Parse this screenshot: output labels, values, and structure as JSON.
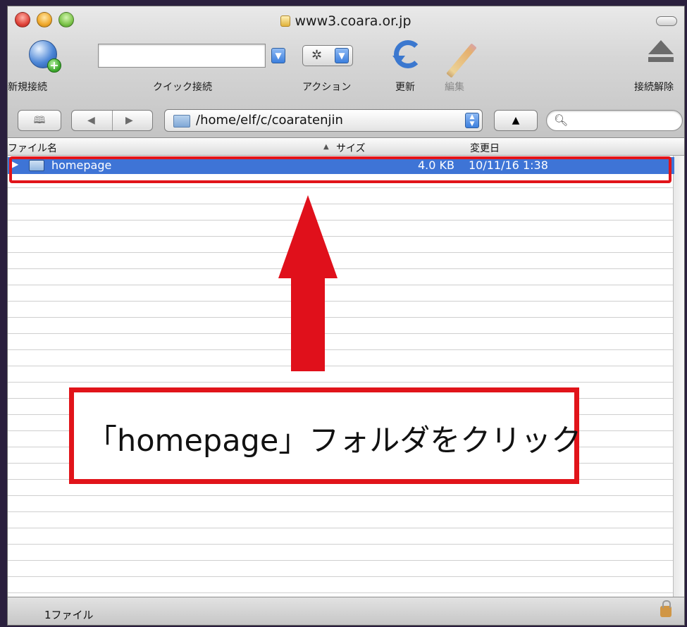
{
  "window": {
    "title": "www3.coara.or.jp"
  },
  "toolbar": {
    "new_connection": "新規接続",
    "quick_connect": "クイック接続",
    "quick_connect_value": "",
    "action": "アクション",
    "refresh": "更新",
    "edit": "編集",
    "disconnect": "接続解除"
  },
  "navigation": {
    "path": "/home/elf/c/coaratenjin",
    "search_value": ""
  },
  "columns": {
    "filename": "ファイル名",
    "size": "サイズ",
    "modified": "変更日"
  },
  "files": [
    {
      "name": "homepage",
      "size": "4.0 KB",
      "modified": "10/11/16 1:38"
    }
  ],
  "annotation": {
    "callout_text": "「homepage」フォルダをクリック"
  },
  "status": {
    "file_count": "1ファイル"
  }
}
